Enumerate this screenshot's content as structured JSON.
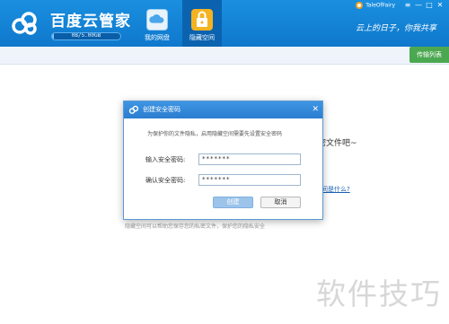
{
  "app": {
    "title": "百度云管家",
    "quota": "0B/5.00GB",
    "quota_used_fraction": 0.02,
    "username": "TaleOfFairy",
    "slogan": "云上的日子，你我共享",
    "window_controls": [
      "≡",
      "—",
      "□",
      "✕"
    ]
  },
  "nav": {
    "tabs": [
      {
        "label": "我的网盘",
        "icon": "cloud-icon",
        "active": false
      },
      {
        "label": "隐藏空间",
        "icon": "lock-icon",
        "active": true
      }
    ]
  },
  "toolbar": {
    "transfer_label": "传输列表"
  },
  "background": {
    "heading_fragment": "密文件吧~",
    "link_fragment": "间是什么?",
    "bottom_text_fragment": "隐藏空间可以帮助您保存您的私密文件，保护您的隐私安全"
  },
  "dialog": {
    "title": "创建安全密码",
    "message": "为保护你的文件隐私，启用隐藏空间需要先设置安全密码",
    "fields": [
      {
        "label": "输入安全密码:",
        "value": "*******"
      },
      {
        "label": "确认安全密码:",
        "value": "*******"
      }
    ],
    "create_label": "创建",
    "cancel_label": "取消",
    "close_glyph": "✕"
  },
  "watermark": "软件技巧",
  "colors": {
    "header": "#1a8fe0",
    "active_tab": "#0b63b0",
    "transfer_button": "#4ca850",
    "link": "#1a5fb4"
  }
}
